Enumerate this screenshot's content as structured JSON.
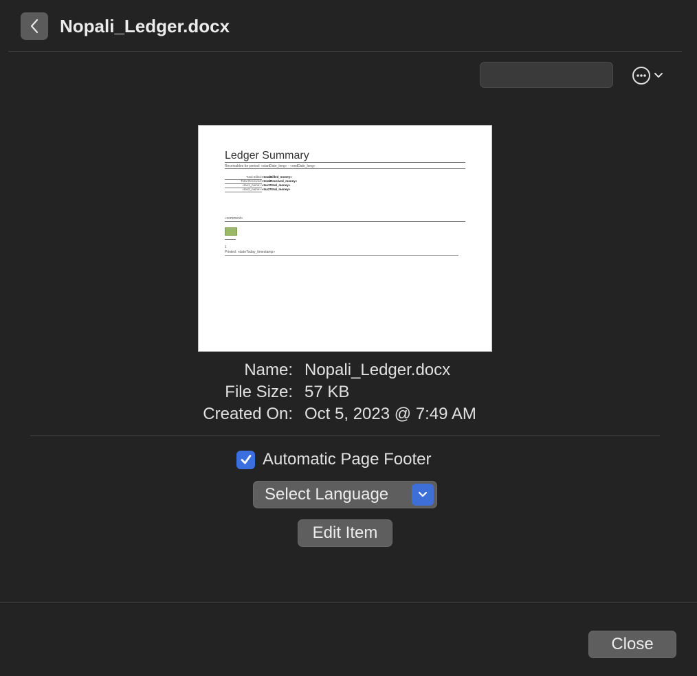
{
  "header": {
    "title": "Nopali_Ledger.docx",
    "back_icon": "chevron-left-icon",
    "more_icon": "ellipsis-circle-icon",
    "search_value": ""
  },
  "preview": {
    "title": "Ledger Summary",
    "subtitle": "Receivables for period: «startDate_long» - «endDate_long»",
    "rows": [
      {
        "label": "Total Billed:",
        "value": "«totalBilled_money»"
      },
      {
        "label": "Total Received:",
        "value": "«totalReceived_money»"
      },
      {
        "label": "«tax1_name»:",
        "value": "«tax1Total_money»"
      },
      {
        "label": "«tax2_name»:",
        "value": "«tax2Total_money»"
      }
    ],
    "comment": "«comment»",
    "page_number": "1",
    "printed": "Printed: «dateToday_timestamp»"
  },
  "info": {
    "name_label": "Name:",
    "name_value": "Nopali_Ledger.docx",
    "size_label": "File Size:",
    "size_value": "57 KB",
    "created_label": "Created On:",
    "created_value": "Oct 5, 2023 @ 7:49 AM"
  },
  "options": {
    "footer_label": "Automatic Page Footer",
    "footer_checked": true,
    "language_label": "Select Language",
    "edit_label": "Edit Item"
  },
  "footer": {
    "close_label": "Close"
  },
  "colors": {
    "accent": "#3b6fe0",
    "background": "#232323",
    "button": "#5e5e5e"
  }
}
